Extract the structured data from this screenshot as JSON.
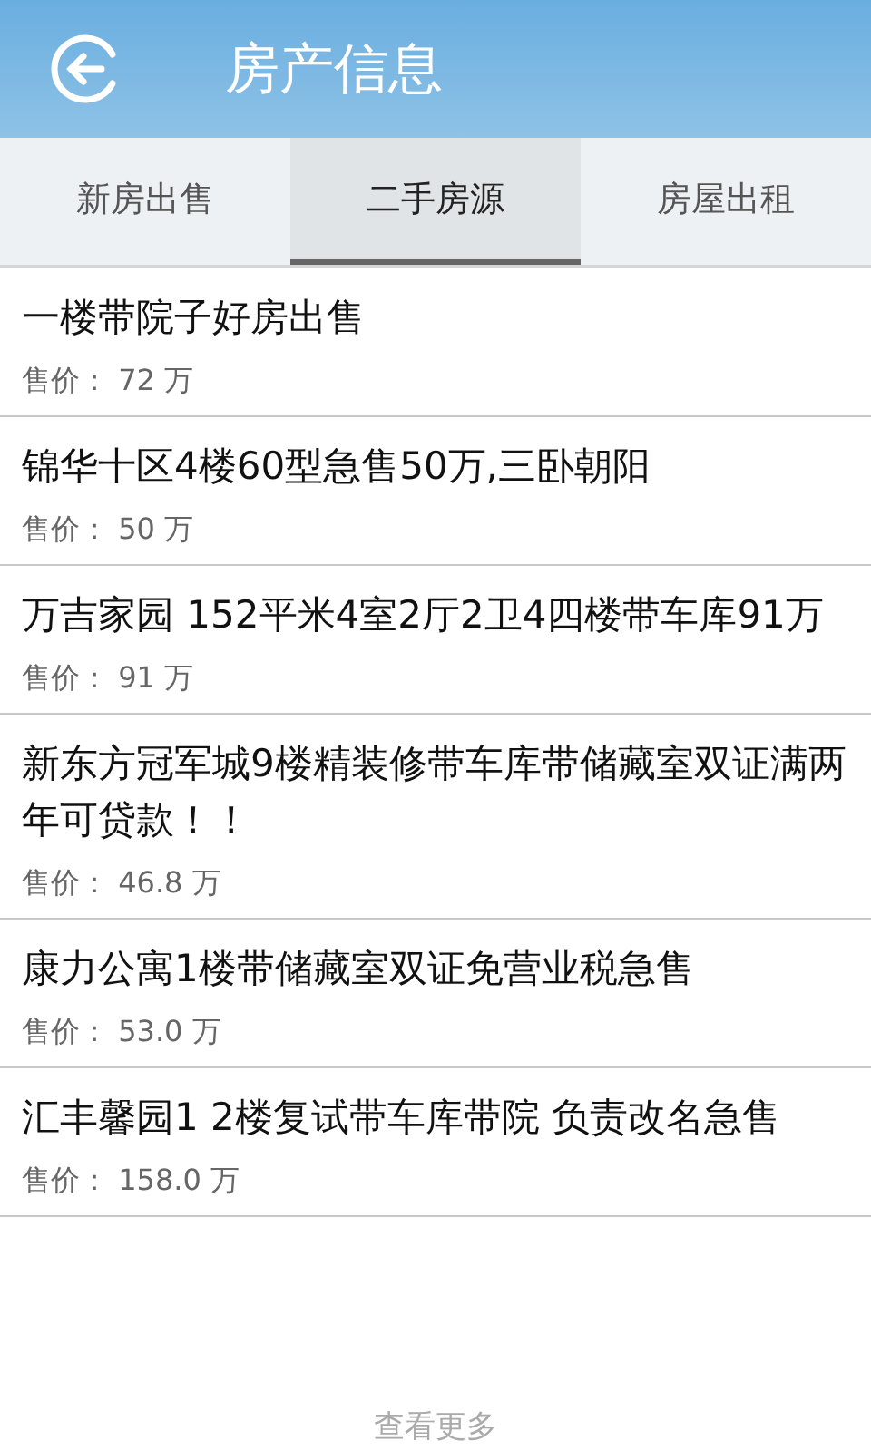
{
  "header": {
    "title": "房产信息"
  },
  "tabs": [
    {
      "label": "新房出售",
      "selected": false
    },
    {
      "label": "二手房源",
      "selected": true
    },
    {
      "label": "房屋出租",
      "selected": false
    }
  ],
  "listings": [
    {
      "title": "一楼带院子好房出售",
      "price": "售价： 72 万"
    },
    {
      "title": "锦华十区4楼60型急售50万,三卧朝阳",
      "price": "售价： 50 万"
    },
    {
      "title": "万吉家园 152平米4室2厅2卫4四楼带车库91万",
      "price": "售价： 91 万"
    },
    {
      "title": "新东方冠军城9楼精装修带车库带储藏室双证满两年可贷款！！",
      "price": "售价： 46.8 万"
    },
    {
      "title": "康力公寓1楼带储藏室双证免营业税急售",
      "price": "售价： 53.0 万"
    },
    {
      "title": "汇丰馨园1 2楼复试带车库带院 负责改名急售",
      "price": "售价： 158.0 万"
    }
  ],
  "more_link": "查看更多"
}
